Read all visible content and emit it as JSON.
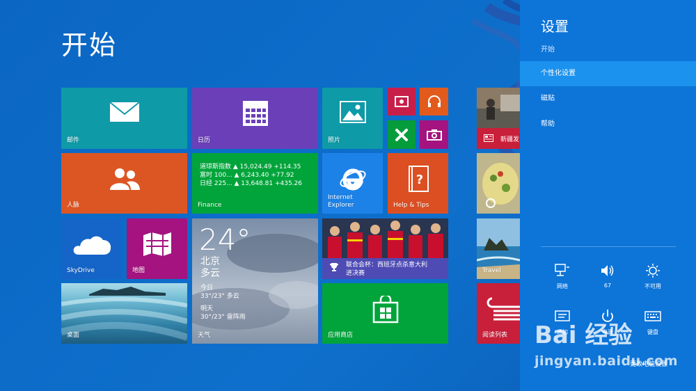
{
  "start": {
    "title": "开始"
  },
  "tiles": {
    "mail": {
      "label": "邮件"
    },
    "calendar": {
      "label": "日历"
    },
    "photos": {
      "label": "照片"
    },
    "people": {
      "label": "人脉"
    },
    "finance": {
      "label": "Finance",
      "rows": [
        {
          "name": "道琼斯指数",
          "value": "▲ 15,024.49 +114.35"
        },
        {
          "name": "富时 100...",
          "value": "▲ 6,243.40 +77.92"
        },
        {
          "name": "日经 225...",
          "value": "▲ 13,648.81 +435.26"
        }
      ]
    },
    "ie": {
      "label_line1": "Internet",
      "label_line2": "Explorer"
    },
    "help": {
      "label": "Help & Tips"
    },
    "skydrive": {
      "label": "SkyDrive"
    },
    "maps": {
      "label": "地图"
    },
    "weather": {
      "label": "天气",
      "temp": "24°",
      "city": "北京",
      "condition": "多云",
      "today_label": "今日",
      "today": "33°/23° 多云",
      "tomorrow_label": "明天",
      "tomorrow": "30°/23° 雷阵雨"
    },
    "sports": {
      "line1": "联合会杯：西班牙点杀意大利",
      "line2": "进决赛"
    },
    "desktop": {
      "label": "桌面"
    },
    "store": {
      "label": "应用商店"
    },
    "news": {
      "label": "新疆发"
    },
    "travel": {
      "label": "Travel"
    },
    "reading": {
      "label": "阅读列表"
    }
  },
  "charm": {
    "title": "设置",
    "subtitle": "开始",
    "items": [
      {
        "label": "个性化设置"
      },
      {
        "label": "磁贴"
      },
      {
        "label": "帮助"
      }
    ],
    "buttons": [
      {
        "label": "网络"
      },
      {
        "label": "67"
      },
      {
        "label": "不可用"
      },
      {
        "label": "通知"
      },
      {
        "label": "电源"
      },
      {
        "label": "键盘"
      }
    ],
    "more": "更改电脑设置"
  },
  "watermark": {
    "logo": "Bai 经验",
    "url": "jingyan.baidu.com"
  },
  "colors": {
    "background": "#0d6bc6",
    "charm": "#0d74d8",
    "charm_active": "#1c92ef",
    "teal": "#0e9aa7",
    "purple": "#6a3fb8",
    "orange": "#dc5624",
    "green": "#01a43a",
    "magenta": "#a4137f",
    "red": "#d01e3a"
  }
}
